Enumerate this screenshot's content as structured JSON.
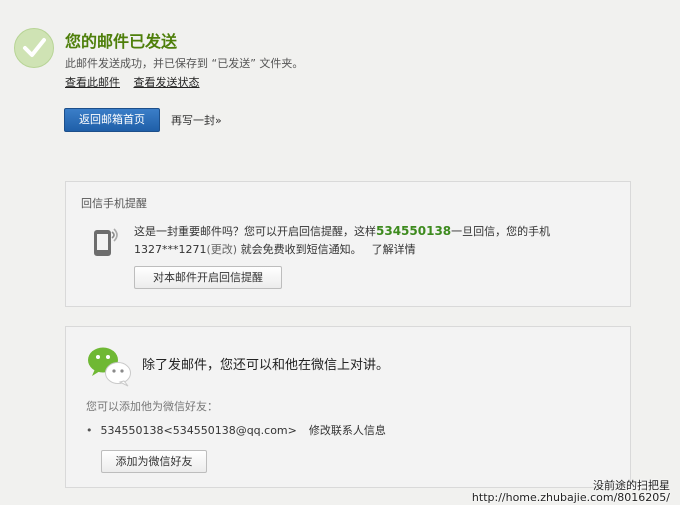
{
  "success": {
    "title": "您的邮件已发送",
    "description": "此邮件发送成功，并已保存到 “已发送” 文件夹。",
    "view_mail_link": "查看此邮件",
    "view_status_link": "查看发送状态",
    "back_button": "返回邮箱首页",
    "rewrite_link": "再写一封»"
  },
  "reply_alert": {
    "title": "回信手机提醒",
    "text_before": "这是一封重要邮件吗？您可以开启回信提醒，这样",
    "number": "534550138",
    "text_after": "一旦回信，您的手机",
    "phone": "1327***1271",
    "change_link": "(更改)",
    "text_line2": " 就会免费收到短信通知。",
    "learn_more": "了解详情",
    "enable_button": "对本邮件开启回信提醒"
  },
  "wechat": {
    "heading": "除了发邮件，您还可以和他在微信上对讲。",
    "subtitle": "您可以添加他为微信好友：",
    "contact": "534550138<534550138@qq.com>",
    "edit_link": "修改联系人信息",
    "add_button": "添加为微信好友"
  },
  "watermark": {
    "line1": "没前途的扫把星",
    "line2": "http://home.zhubajie.com/8016205/"
  },
  "colors": {
    "title_green": "#4e7f0a",
    "primary_blue": "#2a6db7",
    "number_green": "#3d8a1e"
  }
}
